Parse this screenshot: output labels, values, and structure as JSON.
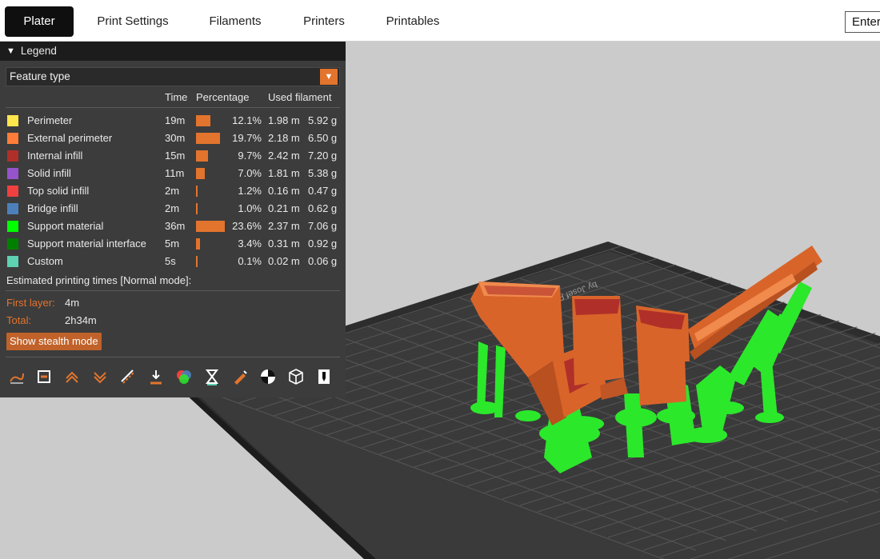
{
  "tabs": [
    {
      "label": "Plater",
      "active": true
    },
    {
      "label": "Print Settings",
      "active": false
    },
    {
      "label": "Filaments",
      "active": false
    },
    {
      "label": "Printers",
      "active": false
    },
    {
      "label": "Printables",
      "active": false
    }
  ],
  "mode_select": {
    "value": "Enter"
  },
  "legend": {
    "title": "Legend",
    "view_type": "Feature type",
    "headers": {
      "time": "Time",
      "percentage": "Percentage",
      "used_filament": "Used filament"
    },
    "features": [
      {
        "name": "Perimeter",
        "color": "#FFE64D",
        "time": "19m",
        "pct": 12.1,
        "pct_label": "12.1%",
        "length": "1.98 m",
        "weight": "5.92 g"
      },
      {
        "name": "External perimeter",
        "color": "#FF7D38",
        "time": "30m",
        "pct": 19.7,
        "pct_label": "19.7%",
        "length": "2.18 m",
        "weight": "6.50 g"
      },
      {
        "name": "Internal infill",
        "color": "#B03029",
        "time": "15m",
        "pct": 9.7,
        "pct_label": "9.7%",
        "length": "2.42 m",
        "weight": "7.20 g"
      },
      {
        "name": "Solid infill",
        "color": "#9654CC",
        "time": "11m",
        "pct": 7.0,
        "pct_label": "7.0%",
        "length": "1.81 m",
        "weight": "5.38 g"
      },
      {
        "name": "Top solid infill",
        "color": "#F04040",
        "time": "2m",
        "pct": 1.2,
        "pct_label": "1.2%",
        "length": "0.16 m",
        "weight": "0.47 g"
      },
      {
        "name": "Bridge infill",
        "color": "#4D80BA",
        "time": "2m",
        "pct": 1.0,
        "pct_label": "1.0%",
        "length": "0.21 m",
        "weight": "0.62 g"
      },
      {
        "name": "Support material",
        "color": "#00FF00",
        "time": "36m",
        "pct": 23.6,
        "pct_label": "23.6%",
        "length": "2.37 m",
        "weight": "7.06 g"
      },
      {
        "name": "Support material interface",
        "color": "#008000",
        "time": "5m",
        "pct": 3.4,
        "pct_label": "3.4%",
        "length": "0.31 m",
        "weight": "0.92 g"
      },
      {
        "name": "Custom",
        "color": "#5ED1B2",
        "time": "5s",
        "pct": 0.1,
        "pct_label": "0.1%",
        "length": "0.02 m",
        "weight": "0.06 g"
      }
    ],
    "estimated_title": "Estimated printing times [Normal mode]:",
    "first_layer_label": "First layer:",
    "first_layer_value": "4m",
    "total_label": "Total:",
    "total_value": "2h34m",
    "stealth_button": "Show stealth mode",
    "toolbar_icons": [
      "travel-icon",
      "wipe-icon",
      "retractions-icon",
      "deretractions-icon",
      "seams-icon",
      "tool-changes-icon",
      "color-changes-icon",
      "pause-prints-icon",
      "custom-gcodes-icon",
      "center-of-gravity-icon",
      "shells-icon",
      "tool-marker-icon"
    ]
  },
  "bed_label": "by Josef Prusa",
  "accent_color": "#E3742D",
  "object_color": "#D9642A",
  "support_color": "#2BE82B"
}
